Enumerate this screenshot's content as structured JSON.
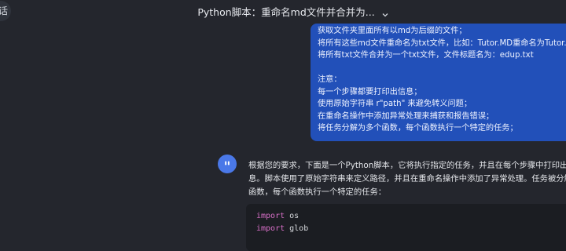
{
  "sidebar": {
    "partial_label": "话"
  },
  "header": {
    "title": "Python脚本：重命名md文件并合并为..."
  },
  "user_message": {
    "lines": [
      "获取文件夹里面所有以md为后缀的文件；",
      "将所有这些md文件重命名为txt文件，比如：Tutor.MD重命名为Tutor.txt",
      "将所有txt文件合并为一个txt文件，文件标题名为：edup.txt",
      "注意：",
      "每一个步骤都要打印出信息；",
      "使用原始字符串 r\"path\" 来避免转义问题；",
      "在重命名操作中添加异常处理来捕获和报告错误；",
      "将任务分解为多个函数，每个函数执行一个特定的任务；"
    ]
  },
  "assistant_message": {
    "lines": [
      "根据您的要求，下面是一个Python脚本，它将执行指定的任务，并且在每个步骤中打印出相",
      "息。脚本使用了原始字符串来定义路径，并且在重命名操作中添加了异常处理。任务被分解",
      "函数，每个函数执行一个特定的任务："
    ],
    "code_lines": [
      {
        "keyword": "import",
        "rest": " os"
      },
      {
        "keyword": "import",
        "rest": " glob"
      }
    ]
  },
  "colors": {
    "background": "#24262d",
    "user_bubble": "#2250b9",
    "code_keyword": "#d76fc7"
  }
}
